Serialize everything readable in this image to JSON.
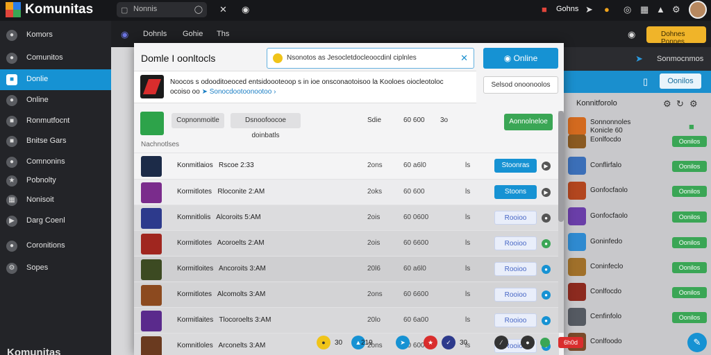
{
  "app": {
    "title": "Komunitas",
    "footer": "Komunitas"
  },
  "top_search": {
    "placeholder": "Nonnis"
  },
  "top_user": {
    "label": "Gohns"
  },
  "subnav": {
    "tabs": [
      "Dohnls",
      "Gohie",
      "Ths"
    ]
  },
  "upgrade_label": "Dohnes Ponnes",
  "sidebar": {
    "items": [
      {
        "label": "Komors",
        "icon": "compass-icon"
      },
      {
        "label": "Comunitos",
        "icon": "community-icon"
      },
      {
        "label": "Donlie",
        "icon": "online-icon"
      },
      {
        "label": "Online",
        "icon": "person-icon"
      },
      {
        "label": "Ronmutfocnt",
        "icon": "document-icon"
      },
      {
        "label": "Bnitse Gars",
        "icon": "folder-icon"
      },
      {
        "label": "Comnonins",
        "icon": "gamepad-icon"
      },
      {
        "label": "Pobnolty",
        "icon": "star-icon"
      },
      {
        "label": "Nonisoit",
        "icon": "puzzle-icon"
      },
      {
        "label": "Darg Coenl",
        "icon": "play-icon"
      },
      {
        "label": "Coronitions",
        "icon": "chat-icon"
      },
      {
        "label": "Sopes",
        "icon": "gear-icon"
      }
    ]
  },
  "dialog": {
    "title": "Domle I oonltocls",
    "search_value": "Nsonotos as Jesocletdocleoocdinl ciplnles",
    "online_label": "Online",
    "info_text": "Noocos s odooditoeoced entsidoooteoop  s  in  ioe  onsconaotoisoo  la  Kooloes  oiocleotoloc",
    "info_text2": "ocoiso  oo",
    "info_link": "Sonocdootoonootoo",
    "action_label": "Selsod onoonoolos",
    "filters": {
      "chip1": "Copnonmoitle",
      "chip2": "Dsnoofoocoe doinbatls",
      "col1": "Sdie",
      "col2": "60 600",
      "col3": "3o",
      "primary_label": "Aonnolneloe"
    },
    "section_label": "Nachnotlses",
    "rows": [
      {
        "name": "Konmitlaios",
        "time": "Rscoe 2:33",
        "c1": "2ons",
        "c2": "60 a6l0",
        "c3": "ls",
        "button": "Stoonras",
        "btn_style": "blue",
        "dot": "gray"
      },
      {
        "name": "Kormitlotes",
        "time": "Rloconite 2:AM",
        "c1": "2oks",
        "c2": "60 600",
        "c3": "ls",
        "button": "Stoons",
        "btn_style": "blue",
        "dot": "gray"
      },
      {
        "name": "Komnitlolis",
        "time": "Alcoroits 5:AM",
        "c1": "2ois",
        "c2": "60 0600",
        "c3": "ls",
        "button": "Rooioo",
        "btn_style": "pale",
        "dot": "gray"
      },
      {
        "name": "Kormitlotes",
        "time": "Acoroelts 2:AM",
        "c1": "2ois",
        "c2": "60 6600",
        "c3": "ls",
        "button": "Rooioo",
        "btn_style": "pale",
        "dot": "green"
      },
      {
        "name": "Kormitloites",
        "time": "Ancoroits 3:AM",
        "c1": "20l6",
        "c2": "60 a6l0",
        "c3": "ls",
        "button": "Rooioo",
        "btn_style": "pale",
        "dot": "blue"
      },
      {
        "name": "Kormitlotes",
        "time": "Alcomolts 3:AM",
        "c1": "2ons",
        "c2": "60 6600",
        "c3": "ls",
        "button": "Rooioo",
        "btn_style": "pale",
        "dot": "blue"
      },
      {
        "name": "Kormitlaites",
        "time": "Tlocoroelts 3:AM",
        "c1": "20lo",
        "c2": "60 6a00",
        "c3": "ls",
        "button": "Rooioo",
        "btn_style": "pale",
        "dot": "blue"
      },
      {
        "name": "Komnitloles",
        "time": "Arconelts 3:AM",
        "c1": "2ons",
        "c2": "60 600",
        "c3": "ls",
        "button": "Rooioo",
        "btn_style": "pale",
        "dot": "blue"
      }
    ]
  },
  "right_panel": {
    "header_label": "Sonmocnmos",
    "tab_label": "Oonilos",
    "title": "Konnitforolo",
    "rows": [
      {
        "name": "Sonnonnoles",
        "sub": "Konicle 60"
      },
      {
        "name": "Eonlfocdo"
      },
      {
        "name": "Conflirfalo"
      },
      {
        "name": "Gonfocfaolo"
      },
      {
        "name": "Gonfocfaolo"
      },
      {
        "name": "Goninfedo"
      },
      {
        "name": "Coninfeclo"
      },
      {
        "name": "Conlfocdo"
      },
      {
        "name": "Cenfinfolo"
      },
      {
        "name": "Conlfoodo"
      }
    ],
    "badge_label": "Oonilos"
  },
  "bottom_bar": {
    "count1": "30",
    "count2": "219",
    "count3": "30",
    "badge": "6h0d"
  },
  "colors": {
    "accent": "#1692d3",
    "success": "#3aa655",
    "warning": "#f0b429",
    "sidebar": "#232428"
  }
}
